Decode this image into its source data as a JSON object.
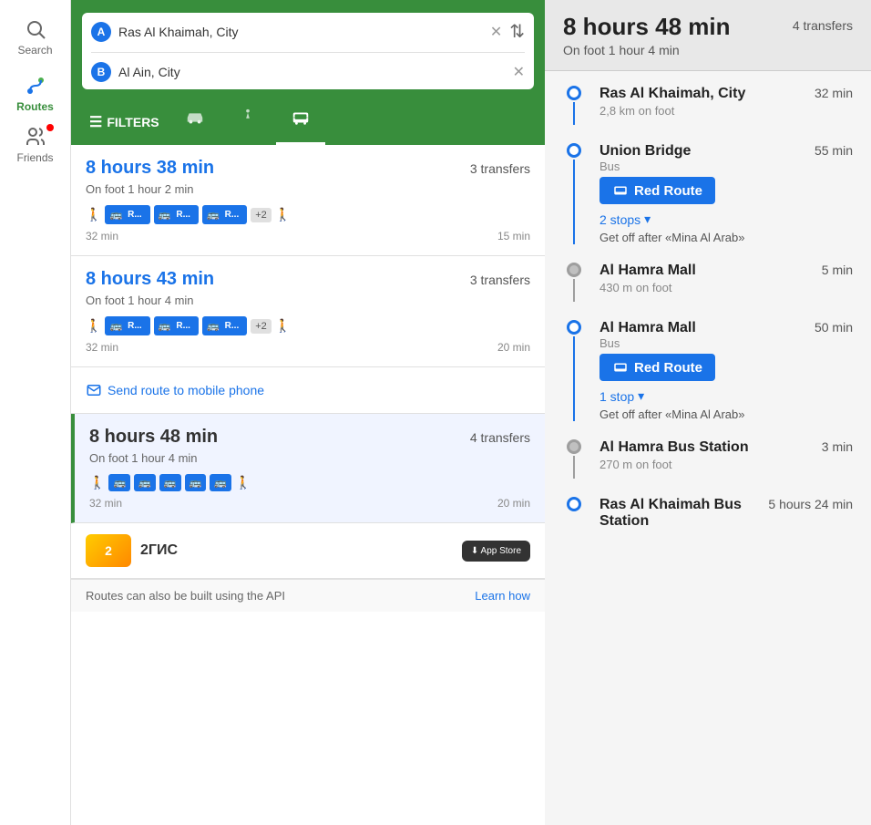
{
  "sidebar": {
    "items": [
      {
        "id": "search",
        "label": "Search",
        "icon": "🔍",
        "active": false
      },
      {
        "id": "routes",
        "label": "Routes",
        "icon": "🗺",
        "active": true
      },
      {
        "id": "friends",
        "label": "Friends",
        "icon": "👥",
        "active": false
      }
    ]
  },
  "search": {
    "point_a": "Ras Al Khaimah, City",
    "point_b": "Al Ain, City",
    "filters_label": "FILTERS"
  },
  "routes": [
    {
      "id": 1,
      "duration": "8 hours 38 min",
      "transfers": "3 transfers",
      "on_foot": "On foot 1 hour 2 min",
      "time_start": "32 min",
      "time_end": "15 min",
      "selected": false
    },
    {
      "id": 2,
      "duration": "8 hours 43 min",
      "transfers": "3 transfers",
      "on_foot": "On foot 1 hour 4 min",
      "time_start": "32 min",
      "time_end": "20 min",
      "selected": false
    },
    {
      "id": 3,
      "duration": "8 hours 48 min",
      "transfers": "4 transfers",
      "on_foot": "On foot 1 hour 4 min",
      "time_start": "32 min",
      "time_end": "20 min",
      "selected": true
    }
  ],
  "send_route": {
    "label": "Send route to mobile phone"
  },
  "footer": {
    "text": "Routes can also be built using the API",
    "learn_how": "Learn how"
  },
  "detail": {
    "duration": "8 hours 48 min",
    "on_foot": "On foot 1 hour 4 min",
    "transfers": "4 transfers",
    "stops": [
      {
        "name": "Ras Al Khaimah, City",
        "time": "32 min",
        "sub": "2,8 km on foot",
        "type": "start"
      },
      {
        "name": "Union Bridge",
        "time": "55 min",
        "sub": "",
        "type": "stop",
        "transport_label": "Bus",
        "route_name": "Red Route",
        "stops_count": "2 stops",
        "get_off": "Get off after «Mina Al Arab»"
      },
      {
        "name": "Al Hamra Mall",
        "time": "5 min",
        "sub": "430 m on foot",
        "type": "stop"
      },
      {
        "name": "Al Hamra Mall",
        "time": "50 min",
        "sub": "",
        "type": "stop",
        "transport_label": "Bus",
        "route_name": "Red Route",
        "stops_count": "1 stop",
        "get_off": "Get off after «Mina Al Arab»"
      },
      {
        "name": "Al Hamra Bus Station",
        "time": "3 min",
        "sub": "270 m on foot",
        "type": "stop"
      },
      {
        "name": "Ras Al Khaimah Bus Station",
        "time": "5 hours 24 min",
        "sub": "",
        "type": "end"
      }
    ]
  }
}
